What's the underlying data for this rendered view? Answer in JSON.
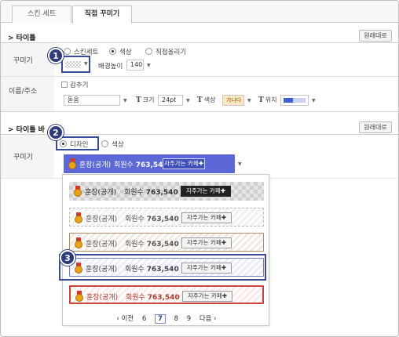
{
  "tabs": [
    {
      "label": "스킨 세트"
    },
    {
      "label": "직접 꾸미기"
    }
  ],
  "title_section": {
    "heading": "> 타이틀",
    "reset": "원래대로",
    "decorate_label": "꾸미기",
    "options": {
      "skin_set": "스킨세트",
      "color": "색상",
      "upload": "직접올리기"
    },
    "bg_height_label": "배경높이",
    "bg_height_value": "140",
    "name_label": "이름/주소",
    "hide_label": "감추기",
    "font_value": "돋움",
    "size_label": "크기",
    "size_value": "24pt",
    "color_label": "색상",
    "color_sample": "가나다",
    "position_label": "위치"
  },
  "titlebar_section": {
    "heading": "> 타이틀 바",
    "reset": "원래대로",
    "decorate_label": "꾸미기",
    "options": {
      "design": "디자인",
      "color": "색상"
    }
  },
  "bar_text": {
    "name": "훈장(공개)",
    "members_label": "회원수",
    "members_count": "763,540",
    "fav_button": "자주가는 카페✚"
  },
  "pager": {
    "prev": "‹ 이전",
    "pages": [
      "6",
      "7",
      "8",
      "9"
    ],
    "current": "7",
    "next": "다음 ›"
  },
  "callouts": [
    "1",
    "2",
    "3"
  ],
  "colors": {
    "selected_bar": "#5b68d6",
    "callout": "#2d3b7a"
  }
}
